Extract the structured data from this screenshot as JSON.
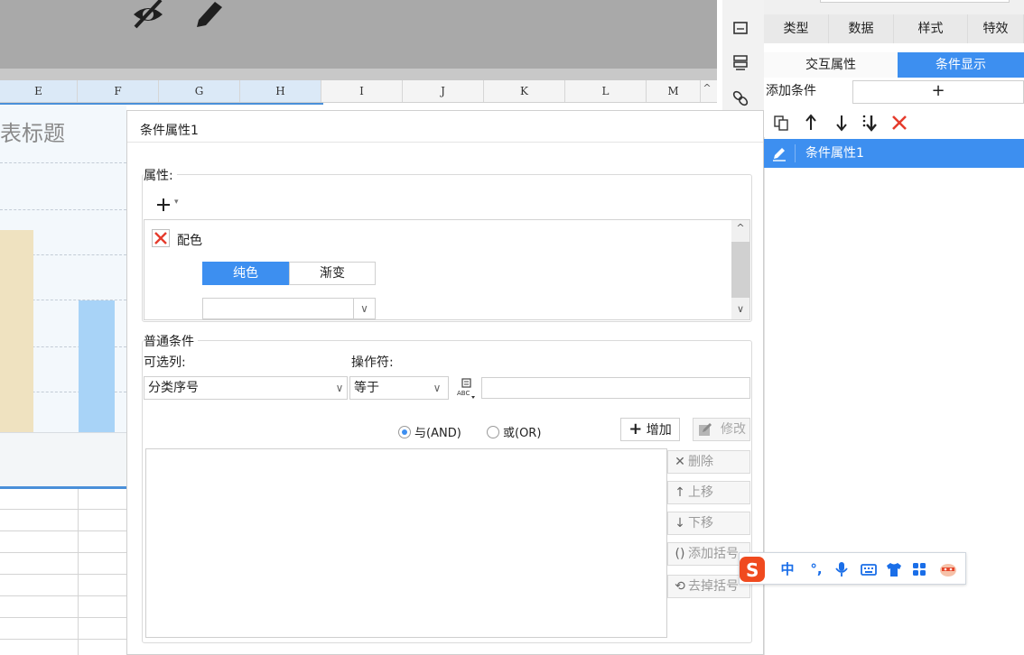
{
  "spreadsheet": {
    "columns": [
      "E",
      "F",
      "G",
      "H",
      "I",
      "J",
      "K",
      "L",
      "M"
    ],
    "chart_title": "表标题"
  },
  "panel": {
    "tabs": [
      "类型",
      "数据",
      "样式",
      "特效"
    ],
    "subtabs": [
      "交互属性",
      "条件显示"
    ],
    "add_condition_label": "添加条件",
    "add_symbol": "+",
    "list_item": "条件属性1",
    "accent": "#3d8ff0"
  },
  "dialog": {
    "title": "条件属性1",
    "attr_group_label": "属性:",
    "attr_name": "配色",
    "segments": [
      "纯色",
      "渐变"
    ],
    "cond_group_label": "普通条件",
    "column_label": "可选列:",
    "column_value": "分类序号",
    "operator_label": "操作符:",
    "operator_value": "等于",
    "radio_and": "与(AND)",
    "radio_or": "或(OR)",
    "add_button": "增加",
    "edit_button": "修改",
    "side_buttons": [
      "删除",
      "上移",
      "下移",
      "添加括号",
      "去掉括号"
    ]
  },
  "ime": {
    "items": [
      "中",
      "°,",
      "mic-icon",
      "keyboard-icon",
      "shirt-icon",
      "apps-icon",
      "mascot-icon"
    ]
  }
}
